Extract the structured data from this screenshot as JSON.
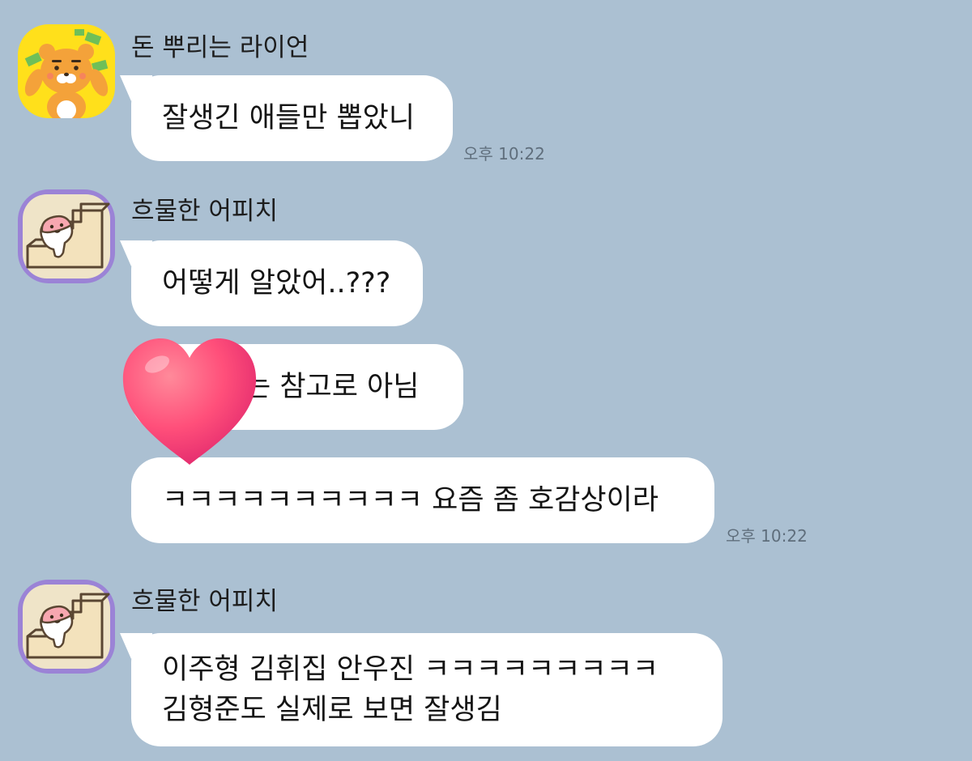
{
  "colors": {
    "background": "#abc0d2",
    "bubble": "#ffffff",
    "heart": "#ff4f7a",
    "ryan_bg": "#ffe01b",
    "apeach_bg": "#9b83d6"
  },
  "messages": [
    {
      "sender": "돈 뿌리는 라이언",
      "avatar_icon": "ryan-throwing-money-icon",
      "bubbles": [
        {
          "text": "잘생긴 애들만 뽑았니",
          "time": "오후 10:22"
        }
      ]
    },
    {
      "sender": "흐물한 어피치",
      "avatar_icon": "apeach-on-stairs-icon",
      "bubbles": [
        {
          "text": "어떻게 알았어..???",
          "time": ""
        },
        {
          "text": "는 참고로 아님",
          "time": "",
          "covered_by": "heart-sticker-icon"
        },
        {
          "text": "ㅋㅋㅋㅋㅋㅋㅋㅋㅋㅋ 요즘 좀 호감상이라",
          "time": "오후 10:22"
        }
      ]
    },
    {
      "sender": "흐물한 어피치",
      "avatar_icon": "apeach-on-stairs-icon",
      "bubbles": [
        {
          "line1": "이주형 김휘집 안우진 ㅋㅋㅋㅋㅋㅋㅋㅋㅋ",
          "line2": "김형준도 실제로 보면 잘생김",
          "time": ""
        }
      ]
    }
  ]
}
